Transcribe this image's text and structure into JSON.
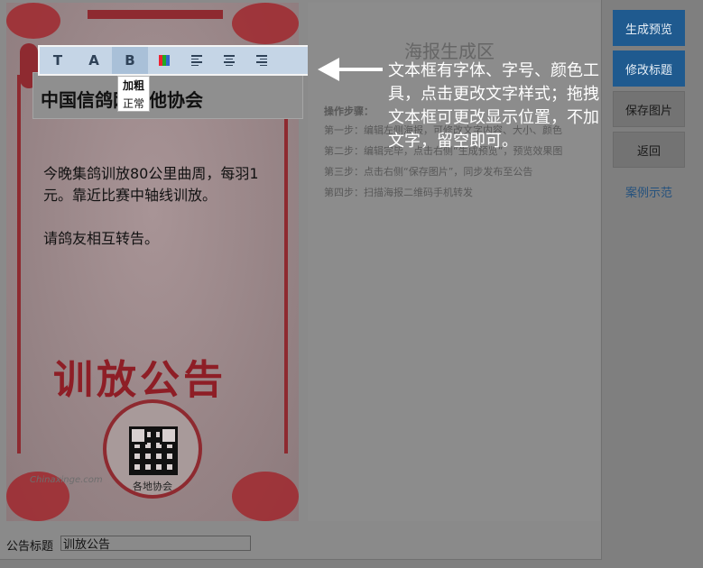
{
  "poster": {
    "headline": "中国信鸽网其他协会",
    "body_lines": [
      "今晚集鸽训放80公里曲周，每羽1元。靠近比赛中轴线训放。",
      "请鸽友相互转告。"
    ],
    "calligraphy": "训放公告",
    "qr_label": "各地协会",
    "watermark": "Chinaxinge.com"
  },
  "toolbar": {
    "font_icon": "T",
    "size_icon": "A",
    "bold_icon": "B",
    "dropdown": [
      "加粗",
      "正常"
    ]
  },
  "info": {
    "title": "海报生成区",
    "steps_header": "操作步骤：",
    "steps": [
      "第一步：编辑左侧海报，可修改文字内容、大小、颜色",
      "第二步：编辑完毕，点击右侧“生成预览”，预览效果图",
      "第三步：点击右侧“保存图片”，同步发布至公告",
      "第四步：扫描海报二维码手机转发"
    ]
  },
  "annotation": "文本框有字体、字号、颜色工具，点击更改文字样式；拖拽文本框可更改显示位置，不加文字，留空即可。",
  "side": {
    "preview": "生成预览",
    "edit_title": "修改标题",
    "save_image": "保存图片",
    "back": "返回",
    "case_demo": "案例示范"
  },
  "form": {
    "title_label": "公告标题",
    "title_value": "训放公告"
  }
}
